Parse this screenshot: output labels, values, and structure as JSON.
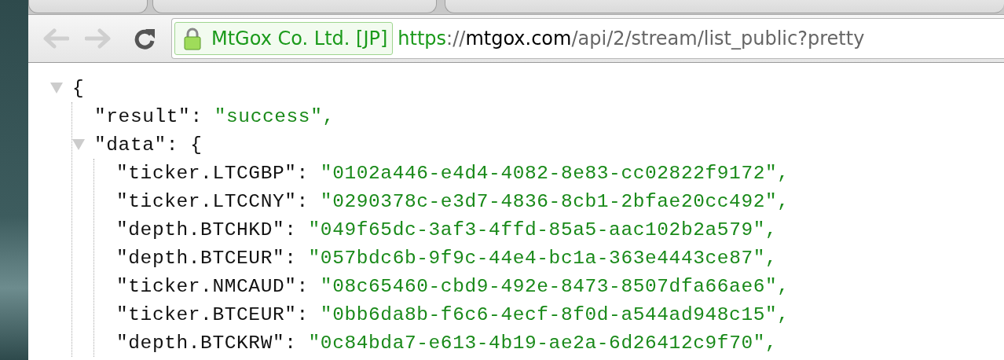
{
  "toolbar": {
    "back": {
      "disabled": true
    },
    "forward": {
      "disabled": true
    }
  },
  "address_bar": {
    "identity": "MtGox Co. Ltd. [JP]",
    "secure": true,
    "scheme": "https",
    "separator": "://",
    "host": "mtgox.com",
    "path": "/api/2/stream/list_public?pretty"
  },
  "json_view": {
    "expanded": true,
    "open": "{",
    "entries": [
      {
        "kind": "string",
        "key": "\"result\":",
        "value": "\"success\","
      },
      {
        "kind": "object",
        "key": "\"data\":",
        "open": "{",
        "expanded": true,
        "children": [
          {
            "kind": "string",
            "key": "\"ticker.LTCGBP\":",
            "value": "\"0102a446-e4d4-4082-8e83-cc02822f9172\","
          },
          {
            "kind": "string",
            "key": "\"ticker.LTCCNY\":",
            "value": "\"0290378c-e3d7-4836-8cb1-2bfae20cc492\","
          },
          {
            "kind": "string",
            "key": "\"depth.BTCHKD\":",
            "value": "\"049f65dc-3af3-4ffd-85a5-aac102b2a579\","
          },
          {
            "kind": "string",
            "key": "\"depth.BTCEUR\":",
            "value": "\"057bdc6b-9f9c-44e4-bc1a-363e4443ce87\","
          },
          {
            "kind": "string",
            "key": "\"ticker.NMCAUD\":",
            "value": "\"08c65460-cbd9-492e-8473-8507dfa66ae6\","
          },
          {
            "kind": "string",
            "key": "\"ticker.BTCEUR\":",
            "value": "\"0bb6da8b-f6c6-4ecf-8f0d-a544ad948c15\","
          },
          {
            "kind": "string",
            "key": "\"depth.BTCKRW\":",
            "value": "\"0c84bda7-e613-4b19-ae2a-6d26412c9f70\","
          }
        ]
      }
    ]
  }
}
